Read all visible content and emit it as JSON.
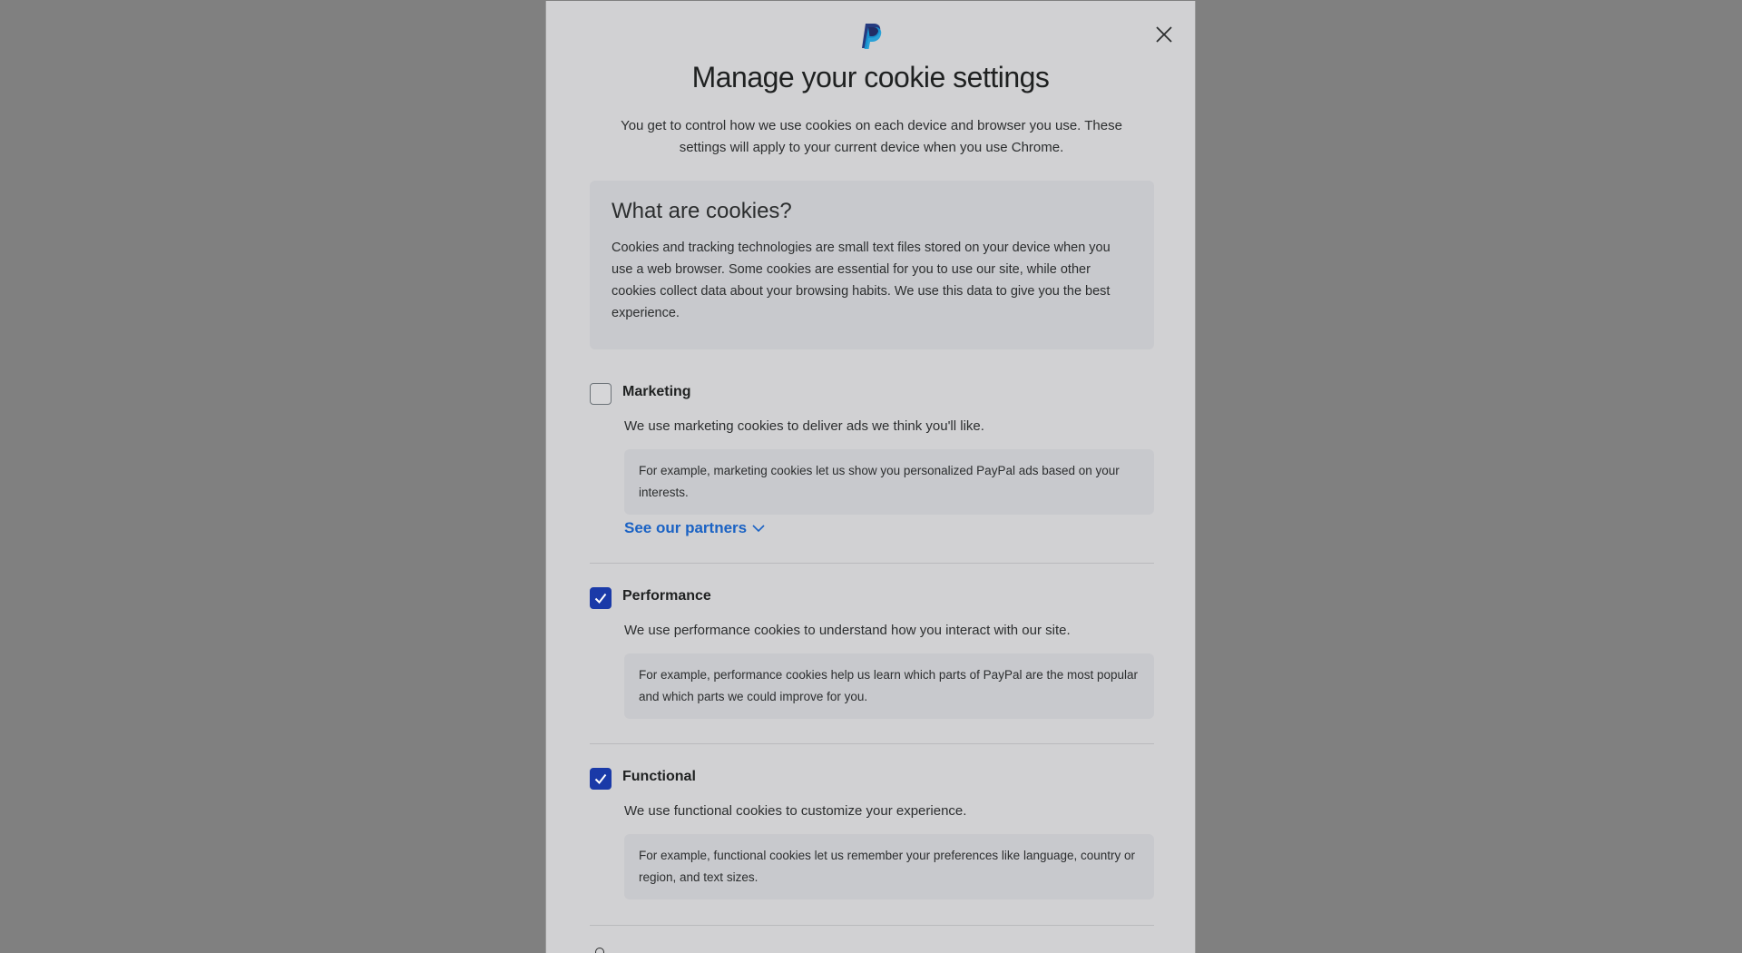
{
  "modal": {
    "title": "Manage your cookie settings",
    "intro": "You get to control how we use cookies on each device and browser you use. These settings will apply to your current device when you use Chrome.",
    "close_icon": "close-icon",
    "logo_icon": "paypal-logo-icon"
  },
  "info": {
    "title": "What are cookies?",
    "text": "Cookies and tracking technologies are small text files stored on your device when you use a web browser. Some cookies are essential for you to use our site, while other cookies collect data about your browsing habits. We use this data to give you the best experience."
  },
  "sections": [
    {
      "label": "Marketing",
      "checked": false,
      "description": "We use marketing cookies to deliver ads we think you'll like.",
      "example": "For example, marketing cookies let us show you personalized PayPal ads based on your interests.",
      "link": "See our partners"
    },
    {
      "label": "Performance",
      "checked": true,
      "description": "We use performance cookies to understand how you interact with our site.",
      "example": "For example, performance cookies help us learn which parts of PayPal are the most popular and which parts we could improve for you."
    },
    {
      "label": "Functional",
      "checked": true,
      "description": "We use functional cookies to customize your experience.",
      "example": "For example, functional cookies let us remember your preferences like language, country or region, and text sizes."
    }
  ],
  "colors": {
    "accent": "#1a3aa8",
    "link": "#1a62c4",
    "overlay": "#808080",
    "panel": "#d1d1d3"
  }
}
